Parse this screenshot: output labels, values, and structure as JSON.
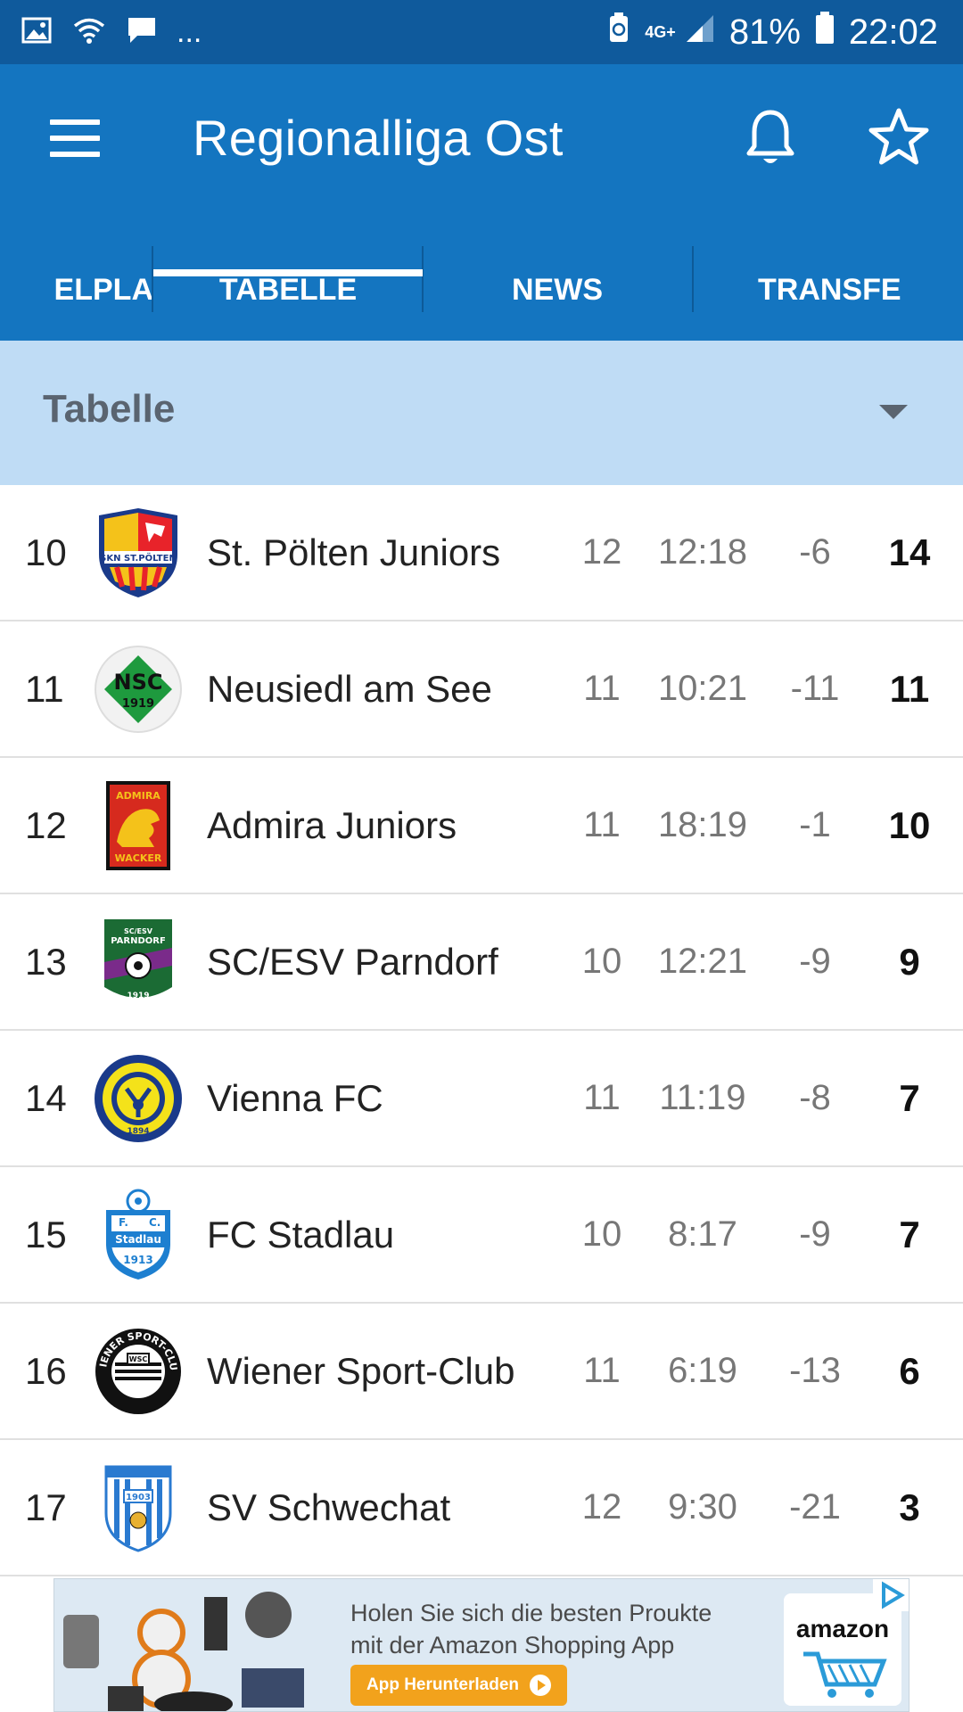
{
  "status_bar": {
    "left_more": "...",
    "network": "4G+",
    "battery_percent": "81%",
    "time": "22:02"
  },
  "app_bar": {
    "title": "Regionalliga Ost"
  },
  "tabs": [
    {
      "label": "SPIELPLAN",
      "visible_text": "ELPLA",
      "active": false
    },
    {
      "label": "TABELLE",
      "visible_text": "TABELLE",
      "active": true
    },
    {
      "label": "NEWS",
      "visible_text": "NEWS",
      "active": false
    },
    {
      "label": "TRANSFERS",
      "visible_text": "TRANSFE",
      "active": false
    }
  ],
  "section": {
    "title": "Tabelle"
  },
  "standings": [
    {
      "rank": "10",
      "team": "St. Pölten Juniors",
      "games": "12",
      "goals": "12:18",
      "diff": "-6",
      "points": "14",
      "logo": "st-poelten-crest"
    },
    {
      "rank": "11",
      "team": "Neusiedl am See",
      "games": "11",
      "goals": "10:21",
      "diff": "-11",
      "points": "11",
      "logo": "nsc-crest",
      "logo_text": "NSC",
      "logo_year": "1919"
    },
    {
      "rank": "12",
      "team": "Admira Juniors",
      "games": "11",
      "goals": "18:19",
      "diff": "-1",
      "points": "10",
      "logo": "admira-crest",
      "logo_text": "ADMIRA",
      "logo_sub": "WACKER"
    },
    {
      "rank": "13",
      "team": "SC/ESV Parndorf",
      "games": "10",
      "goals": "12:21",
      "diff": "-9",
      "points": "9",
      "logo": "parndorf-crest",
      "logo_text": "PARNDORF",
      "logo_year": "1919"
    },
    {
      "rank": "14",
      "team": "Vienna FC",
      "games": "11",
      "goals": "11:19",
      "diff": "-8",
      "points": "7",
      "logo": "vienna-crest",
      "logo_year": "1894"
    },
    {
      "rank": "15",
      "team": "FC Stadlau",
      "games": "10",
      "goals": "8:17",
      "diff": "-9",
      "points": "7",
      "logo": "stadlau-crest",
      "logo_text": "Stadlau",
      "logo_year": "1913"
    },
    {
      "rank": "16",
      "team": "Wiener Sport-Club",
      "games": "11",
      "goals": "6:19",
      "diff": "-13",
      "points": "6",
      "logo": "wsc-crest",
      "logo_text": "WSC"
    },
    {
      "rank": "17",
      "team": "SV Schwechat",
      "games": "12",
      "goals": "9:30",
      "diff": "-21",
      "points": "3",
      "logo": "schwechat-crest",
      "logo_year": "1903"
    }
  ],
  "ad": {
    "text": "Holen Sie sich die besten Proukte mit der Amazon Shopping App",
    "cta": "App Herunterladen",
    "brand": "amazon"
  },
  "colors": {
    "status_bar": "#0f5a9c",
    "app_bar": "#1475c0",
    "section_header": "#bfdcf5",
    "section_text": "#5a6470"
  }
}
